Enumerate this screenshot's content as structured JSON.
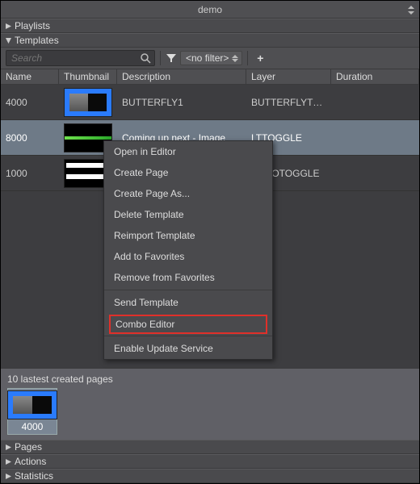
{
  "title": "demo",
  "sections": {
    "playlists": "Playlists",
    "templates": "Templates",
    "pages": "Pages",
    "actions": "Actions",
    "statistics": "Statistics"
  },
  "search": {
    "placeholder": "Search"
  },
  "filter": {
    "label": "<no filter>"
  },
  "columns": {
    "name": "Name",
    "thumbnail": "Thumbnail",
    "description": "Description",
    "layer": "Layer",
    "duration": "Duration"
  },
  "rows": [
    {
      "name": "4000",
      "description": "BUTTERFLY1",
      "layer": "BUTTERFLYTO...",
      "duration": "",
      "thumb": "a",
      "selected": false
    },
    {
      "name": "8000",
      "description": "Coming up next - Image",
      "layer": "LTTOGGLE",
      "duration": "",
      "thumb": "b",
      "selected": true
    },
    {
      "name": "1000",
      "description": "",
      "layer": "LOGOTOGGLE",
      "duration": "",
      "thumb": "c",
      "selected": false
    }
  ],
  "context_menu": {
    "items": [
      "Open in Editor",
      "Create Page",
      "Create Page As...",
      "Delete Template",
      "Reimport Template",
      "Add to Favorites",
      "Remove from Favorites"
    ],
    "group2": [
      "Send Template",
      "Combo Editor"
    ],
    "group3": [
      "Enable Update Service"
    ],
    "highlighted": "Combo Editor"
  },
  "recent": {
    "label": "10 lastest created pages",
    "items": [
      {
        "caption": "4000",
        "selected": true,
        "thumb": "a"
      }
    ]
  }
}
